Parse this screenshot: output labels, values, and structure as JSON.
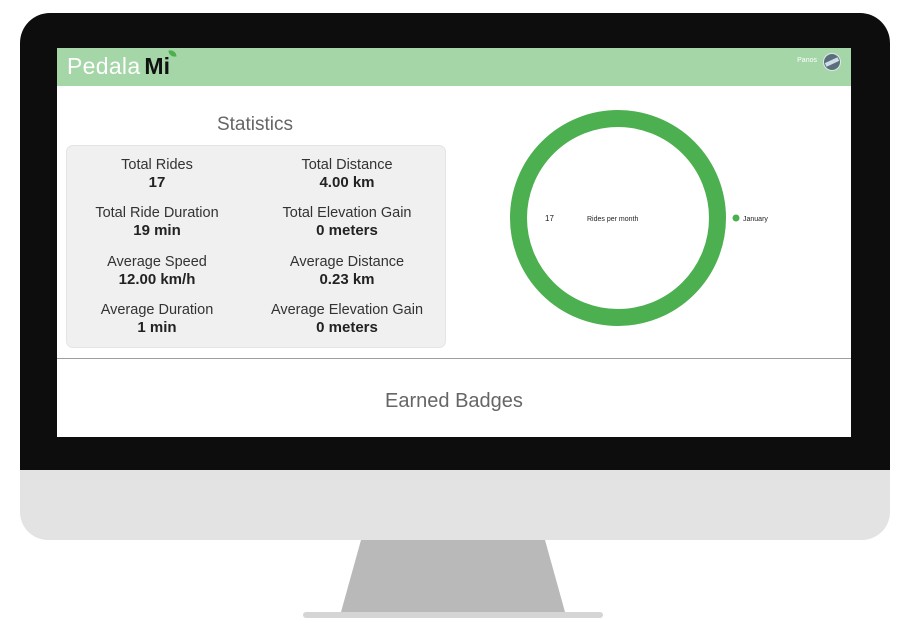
{
  "app": {
    "brand_light": "Pedala",
    "brand_bold": "Mi",
    "username": "Panos",
    "header_color": "#a5d6a7"
  },
  "statistics": {
    "title": "Statistics",
    "items": [
      {
        "label": "Total Rides",
        "value": "17"
      },
      {
        "label": "Total Distance",
        "value": "4.00 km"
      },
      {
        "label": "Total Ride Duration",
        "value": "19 min"
      },
      {
        "label": "Total Elevation Gain",
        "value": "0 meters"
      },
      {
        "label": "Average Speed",
        "value": "12.00 km/h"
      },
      {
        "label": "Average Distance",
        "value": "0.23 km"
      },
      {
        "label": "Average Duration",
        "value": "1 min"
      },
      {
        "label": "Average Elevation Gain",
        "value": "0 meters"
      }
    ]
  },
  "chart_data": {
    "type": "pie",
    "title": "Rides per month",
    "center_value": "17",
    "categories": [
      "January"
    ],
    "values": [
      17
    ],
    "colors": [
      "#4caf50"
    ],
    "legend_position": "right"
  },
  "badges": {
    "title": "Earned Badges"
  },
  "icons": {
    "avatar": "user-avatar-icon"
  }
}
